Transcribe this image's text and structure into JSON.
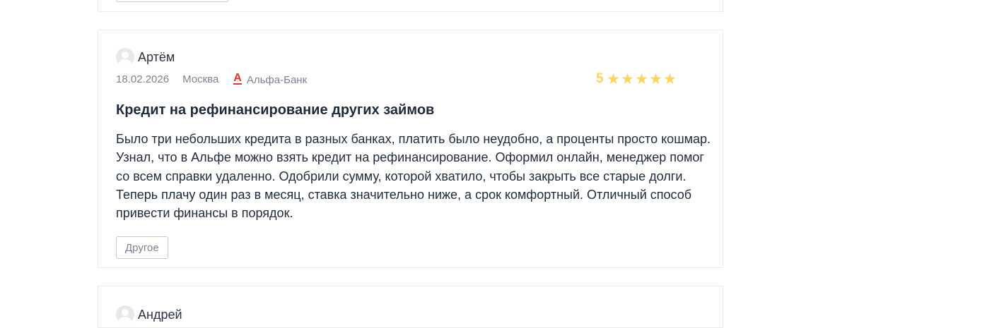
{
  "reviews": [
    {
      "author": "Артём",
      "date": "18.02.2026",
      "city": "Москва",
      "bank": "Альфа-Банк",
      "bank_icon": "А",
      "rating": "5",
      "stars": 5,
      "title": "Кредит на рефинансирование других займов",
      "text": "Было три небольших кредита в разных банках, платить было неудобно, а проценты просто кошмар. Узнал, что в Альфе можно взять кредит на рефинансирование. Оформил онлайн, менеджер помог со всем справки удаленно. Одобрили сумму, которой хватило, чтобы закрыть все старые долги. Теперь плачу один раз в месяц, ставка значительно ниже, а срок комфортный. Отличный способ привести финансы в порядок.",
      "tag": "Другое"
    },
    {
      "author": "Андрей"
    }
  ],
  "colors": {
    "star": "#ffd35a",
    "bank_brand": "#ef3124",
    "border": "#ebebeb"
  },
  "icons": {
    "avatar": "user-avatar-icon",
    "bank": "alfa-bank-logo-icon",
    "star": "star-icon"
  }
}
